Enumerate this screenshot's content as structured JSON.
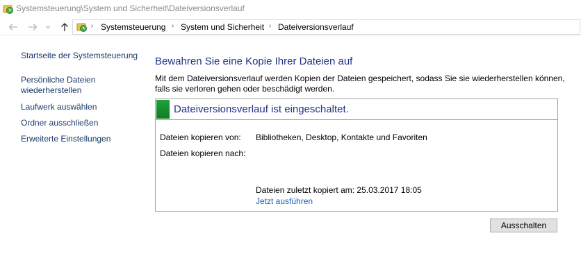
{
  "window": {
    "title": "Systemsteuerung\\System und Sicherheit\\Dateiversionsverlauf"
  },
  "navigation": {
    "breadcrumbs": [
      "Systemsteuerung",
      "System und Sicherheit",
      "Dateiversionsverlauf"
    ],
    "icons": {
      "back": "arrow-left-icon",
      "forward": "arrow-right-icon",
      "recent": "chevron-down-icon",
      "up": "arrow-up-icon",
      "location": "file-history-icon"
    }
  },
  "sidebar": {
    "items": [
      {
        "label": "Startseite der Systemsteuerung"
      },
      {
        "label": "Persönliche Dateien wiederherstellen"
      },
      {
        "label": "Laufwerk auswählen"
      },
      {
        "label": "Ordner ausschließen"
      },
      {
        "label": "Erweiterte Einstellungen"
      }
    ]
  },
  "main": {
    "title": "Bewahren Sie eine Kopie Ihrer Dateien auf",
    "description": "Mit dem Dateiversionsverlauf werden Kopien der Dateien gespeichert, sodass Sie sie wiederherstellen können, falls sie verloren gehen oder beschädigt werden.",
    "status": {
      "title": "Dateiversionsverlauf ist eingeschaltet.",
      "indicator_color": "#1a9a35",
      "copy_from_label": "Dateien kopieren von:",
      "copy_from_value": "Bibliotheken, Desktop, Kontakte und Favoriten",
      "copy_to_label": "Dateien kopieren nach:",
      "copy_to_value": "",
      "last_copied": "Dateien zuletzt kopiert am: 25.03.2017 18:05",
      "run_now": "Jetzt ausführen"
    },
    "turn_off_button": "Ausschalten"
  },
  "colors": {
    "heading": "#1e3287",
    "link": "#1a3a6b",
    "action_link": "#1a5fb4"
  }
}
